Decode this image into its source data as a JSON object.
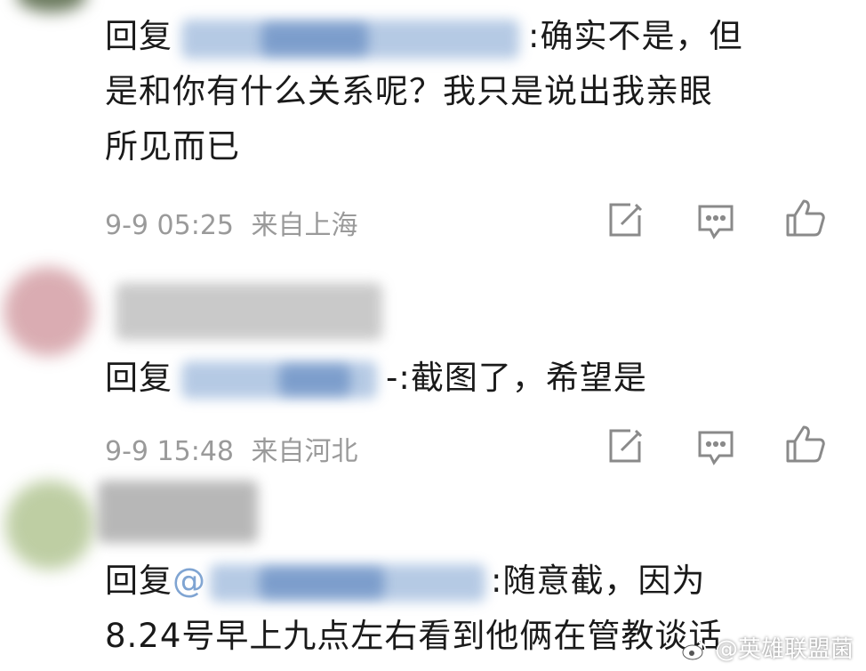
{
  "comments": [
    {
      "reply_prefix": "回复",
      "text_line1_tail": ":确实不是，但",
      "text_line2": "是和你有什么关系呢？我只是说出我亲眼",
      "text_line3": "所见而已",
      "date": "9-9 05:25",
      "location": "来自上海"
    },
    {
      "reply_prefix": "回复",
      "text_tail": "-:截图了，希望是",
      "date": "9-9 15:48",
      "location": "来自河北"
    },
    {
      "reply_prefix": "回复",
      "mention_at": "@",
      "text_line1_tail": ":随意截，因为",
      "text_line2": "8.24号早上九点左右看到他俩在管教谈话"
    }
  ],
  "icons": [
    "edit-icon",
    "comment-icon",
    "like-icon"
  ],
  "watermark": {
    "platform_icon": "weibo-icon",
    "text": "@英雄联盟菌"
  },
  "colors": {
    "text": "#1a1a1a",
    "meta": "#9a9a9a",
    "icon": "#8a8a8a",
    "mention_blur": "#7fa4d2"
  }
}
